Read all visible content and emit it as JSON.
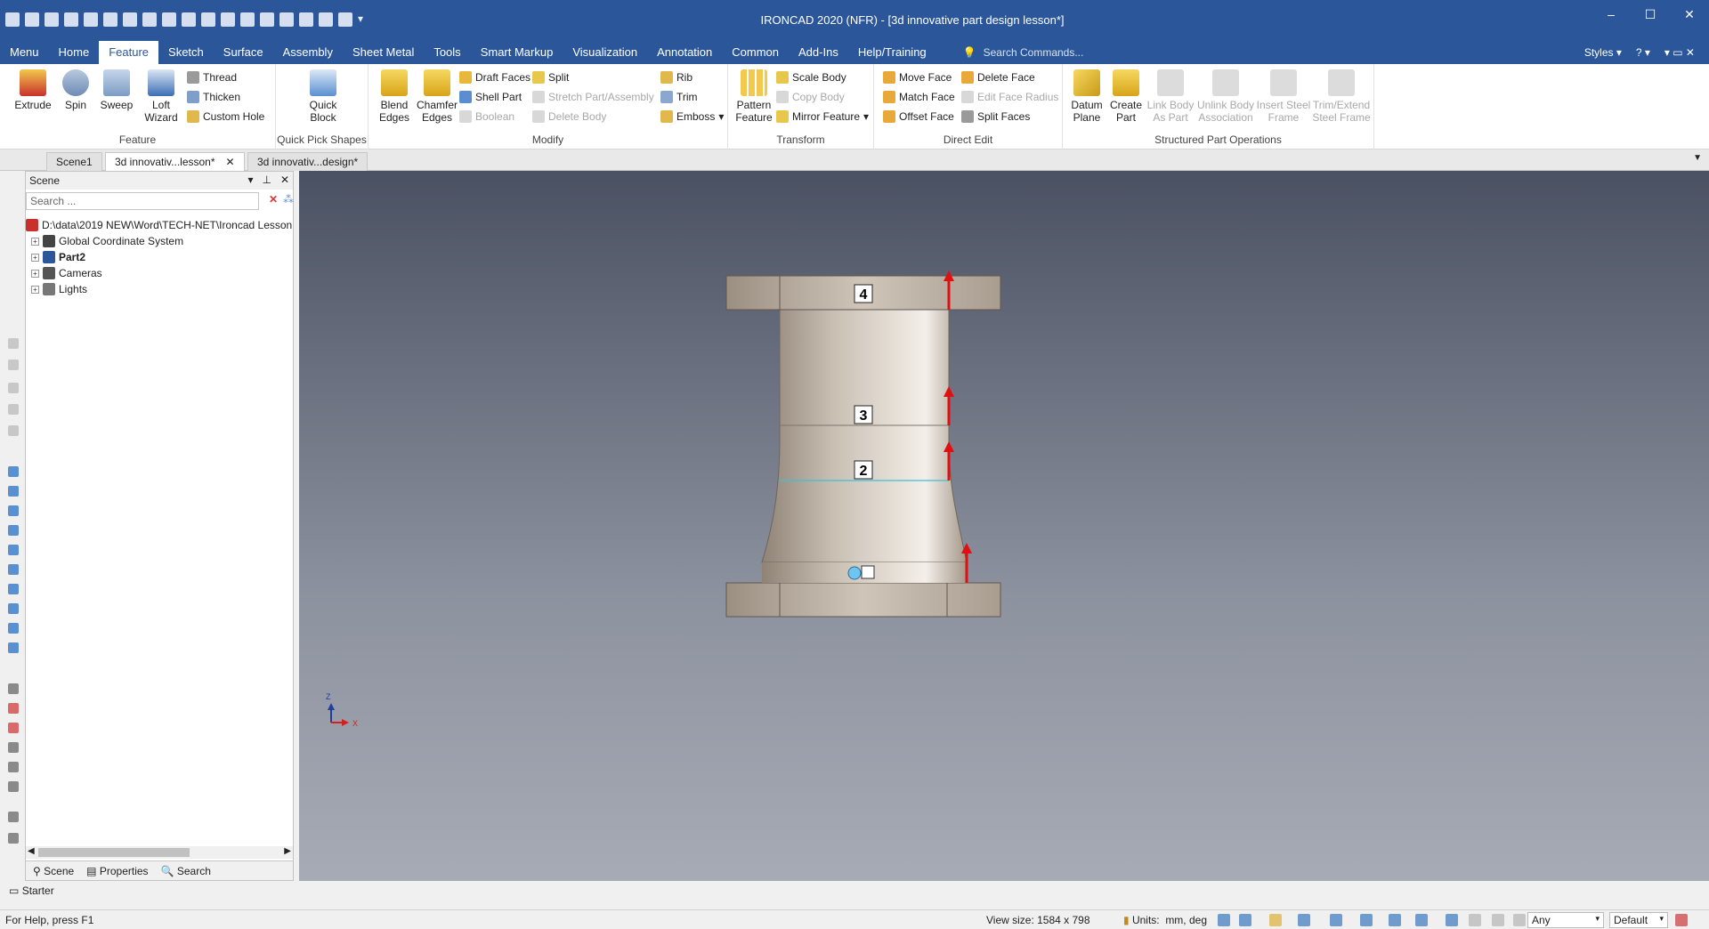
{
  "app": {
    "title": "IRONCAD 2020 (NFR) - [3d innovative part design lesson*]",
    "window_controls": [
      "–",
      "☐",
      "✕"
    ]
  },
  "menubar": {
    "tabs": [
      "Menu",
      "Home",
      "Feature",
      "Sketch",
      "Surface",
      "Assembly",
      "Sheet Metal",
      "Tools",
      "Smart Markup",
      "Visualization",
      "Annotation",
      "Common",
      "Add-Ins",
      "Help/Training"
    ],
    "active_tab": "Feature",
    "search_placeholder": "Search Commands...",
    "styles_label": "Styles"
  },
  "ribbon": {
    "feature": {
      "label": "Feature",
      "extrude": "Extrude",
      "spin": "Spin",
      "sweep": "Sweep",
      "loft": "Loft Wizard",
      "thread": "Thread",
      "thicken": "Thicken",
      "custom_hole": "Custom Hole"
    },
    "quick_pick": {
      "label": "Quick Pick Shapes",
      "quick_block": "Quick Block"
    },
    "modify": {
      "label": "Modify",
      "blend": "Blend Edges",
      "chamfer": "Chamfer Edges",
      "draft_faces": "Draft Faces",
      "shell_part": "Shell Part",
      "boolean": "Boolean",
      "split": "Split",
      "stretch": "Stretch Part/Assembly",
      "delete_body": "Delete Body",
      "rib": "Rib",
      "trim": "Trim",
      "emboss": "Emboss"
    },
    "transform": {
      "label": "Transform",
      "pattern": "Pattern Feature",
      "scale_body": "Scale Body",
      "copy_body": "Copy Body",
      "mirror": "Mirror Feature"
    },
    "direct_edit": {
      "label": "Direct Edit",
      "move_face": "Move Face",
      "match_face": "Match Face",
      "offset_face": "Offset Face",
      "delete_face": "Delete Face",
      "edit_face_radius": "Edit Face Radius",
      "split_faces": "Split Faces"
    },
    "structured": {
      "label": "Structured Part Operations",
      "datum_plane": "Datum Plane",
      "create_part": "Create Part",
      "link_body": "Link Body As Part",
      "unlink_body": "Unlink Body Association",
      "insert_steel": "Insert Steel Frame",
      "trim_steel": "Trim/Extend Steel Frame"
    }
  },
  "doc_tabs": [
    {
      "label": "Scene1",
      "active": false
    },
    {
      "label": "3d innovativ...lesson*",
      "active": true
    },
    {
      "label": "3d innovativ...design*",
      "active": false
    }
  ],
  "scene_panel": {
    "title": "Scene",
    "search_placeholder": "Search ...",
    "tree": [
      {
        "label": "D:\\data\\2019 NEW\\Word\\TECH-NET\\Ironcad Lesson",
        "bold": false,
        "root": true
      },
      {
        "label": "Global Coordinate System",
        "bold": false
      },
      {
        "label": "Part2",
        "bold": true
      },
      {
        "label": "Cameras",
        "bold": false
      },
      {
        "label": "Lights",
        "bold": false
      }
    ],
    "bottom_tabs": [
      "Scene",
      "Properties",
      "Search"
    ]
  },
  "starter": "Starter",
  "viewport": {
    "labels": [
      "4",
      "3",
      "2"
    ],
    "axes": {
      "z": "Z",
      "x": "X"
    }
  },
  "status": {
    "help": "For Help, press F1",
    "view_size": "View size: 1584 x  798",
    "units_label": "Units:",
    "units_value": "mm, deg",
    "selection": "Any",
    "style": "Default"
  }
}
